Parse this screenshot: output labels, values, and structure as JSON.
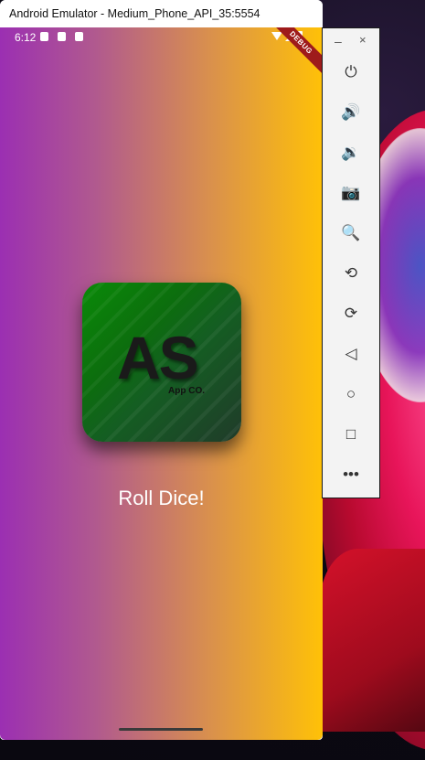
{
  "window": {
    "title": "Android Emulator - Medium_Phone_API_35:5554"
  },
  "status_bar": {
    "time": "6:12"
  },
  "debug_banner": "DEBUG",
  "logo": {
    "main_text": "AS",
    "sub_text": "App CO."
  },
  "roll_button": {
    "label": "Roll Dice!"
  },
  "toolbar": {
    "minimize_label": "–",
    "close_label": "×",
    "items": [
      {
        "name": "power-icon",
        "glyph": "⏻"
      },
      {
        "name": "volume-up-icon",
        "glyph": "🔊"
      },
      {
        "name": "volume-down-icon",
        "glyph": "🔉"
      },
      {
        "name": "camera-icon",
        "glyph": "📷"
      },
      {
        "name": "zoom-icon",
        "glyph": "🔍"
      },
      {
        "name": "rotate-left-icon",
        "glyph": "⟲"
      },
      {
        "name": "rotate-right-icon",
        "glyph": "⟳"
      },
      {
        "name": "back-icon",
        "glyph": "◁"
      },
      {
        "name": "home-icon",
        "glyph": "○"
      },
      {
        "name": "overview-icon",
        "glyph": "□"
      },
      {
        "name": "more-icon",
        "glyph": "•••"
      }
    ]
  },
  "colors": {
    "gradient_start": "#9b2fb2",
    "gradient_end": "#ffc107",
    "logo_green": "#0a8a08"
  }
}
